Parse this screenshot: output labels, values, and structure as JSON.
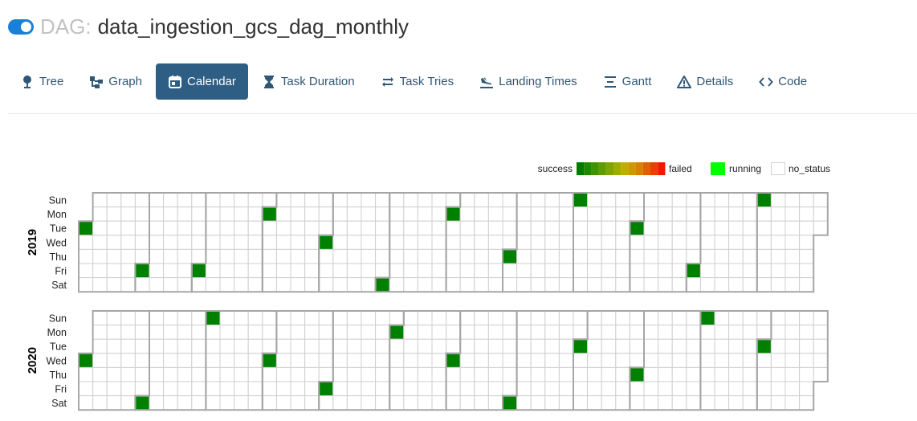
{
  "header": {
    "prefix": "DAG:",
    "dag_id": "data_ingestion_gcs_dag_monthly",
    "paused": false
  },
  "tabs": [
    {
      "label": "Tree",
      "icon": "tree-icon",
      "active": false
    },
    {
      "label": "Graph",
      "icon": "graph-icon",
      "active": false
    },
    {
      "label": "Calendar",
      "icon": "calendar-icon",
      "active": true
    },
    {
      "label": "Task Duration",
      "icon": "hourglass-icon",
      "active": false
    },
    {
      "label": "Task Tries",
      "icon": "retry-icon",
      "active": false
    },
    {
      "label": "Landing Times",
      "icon": "plane-landing-icon",
      "active": false
    },
    {
      "label": "Gantt",
      "icon": "gantt-icon",
      "active": false
    },
    {
      "label": "Details",
      "icon": "warning-triangle-icon",
      "active": false
    },
    {
      "label": "Code",
      "icon": "code-icon",
      "active": false
    }
  ],
  "legend": {
    "success": "success",
    "failed": "failed",
    "running": "running",
    "no_status": "no_status",
    "gradient": [
      "#007a00",
      "#1f8a00",
      "#3f9300",
      "#5e9c00",
      "#7ea500",
      "#9eae00",
      "#bfae00",
      "#cf9800",
      "#d98000",
      "#e06000",
      "#e84000",
      "#f01800"
    ],
    "running_color": "#00ff00",
    "success_color": "#008000"
  },
  "calendar": {
    "weekdays": [
      "Sun",
      "Mon",
      "Tue",
      "Wed",
      "Thu",
      "Fri",
      "Sat"
    ],
    "years": [
      {
        "year": "2019",
        "success_dates": [
          "2019-01-01",
          "2019-02-01",
          "2019-03-01",
          "2019-04-01",
          "2019-05-01",
          "2019-06-01",
          "2019-07-01",
          "2019-08-01",
          "2019-09-01",
          "2019-10-01",
          "2019-11-01",
          "2019-12-01"
        ]
      },
      {
        "year": "2020",
        "success_dates": [
          "2020-01-01",
          "2020-02-01",
          "2020-03-01",
          "2020-04-01",
          "2020-05-01",
          "2020-06-01",
          "2020-07-01",
          "2020-08-01",
          "2020-09-01",
          "2020-10-01",
          "2020-11-01",
          "2020-12-01"
        ]
      }
    ]
  }
}
